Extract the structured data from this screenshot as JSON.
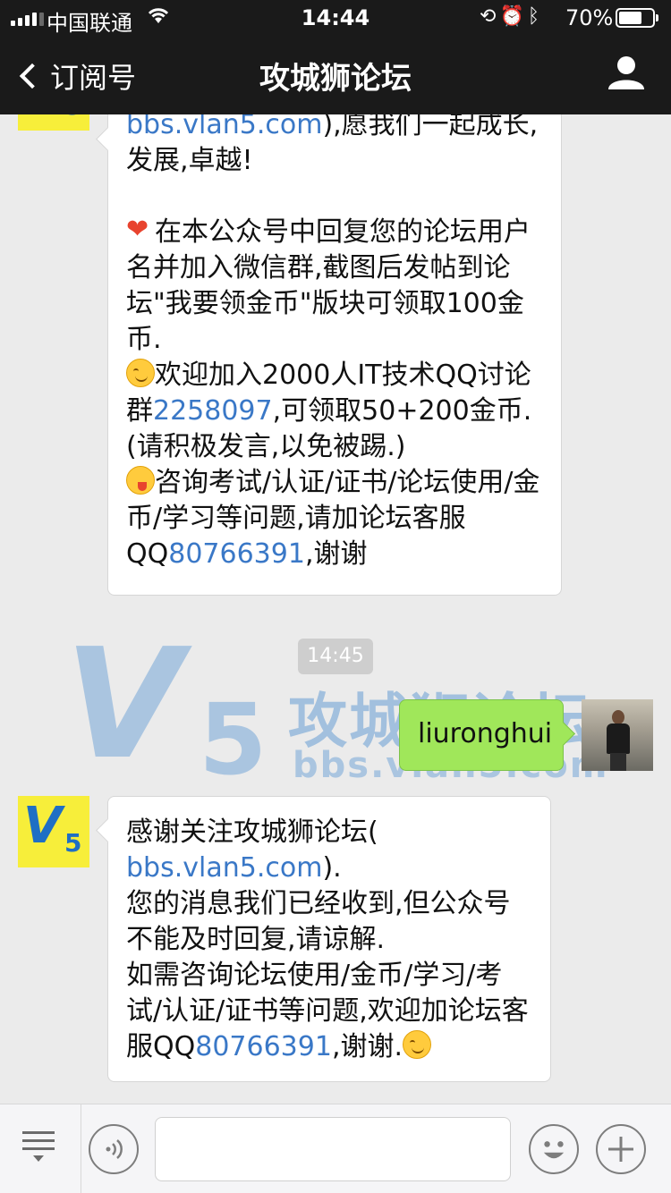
{
  "status_bar": {
    "carrier": "中国联通",
    "time": "14:44",
    "battery": "70%",
    "battery_level": 0.7
  },
  "nav": {
    "back_label": "订阅号",
    "title": "攻城狮论坛"
  },
  "messages": {
    "first_partial": {
      "line1_link": "bbs.vlan5.com",
      "line1_rest": "),愿我们一起成长,",
      "line2": "发展,卓越!",
      "heart_text": "在本公众号中回复您的论坛用户名并加入微信群,截图后发帖到论坛\"我要领金币\"版块可领取100金币.",
      "qq_group_prefix": "欢迎加入2000人IT技术QQ讨论群",
      "qq_group_number": "2258097",
      "qq_group_suffix": ",可领取50+200金币.(请积极发言,以免被踢.)",
      "consult_prefix": "咨询考试/认证/证书/论坛使用/金币/学习等问题,请加论坛客服QQ",
      "consult_qq": "80766391",
      "consult_suffix": ",谢谢"
    },
    "timestamp": "14:45",
    "user_message": "liuronghui",
    "reply": {
      "line1": "感谢关注攻城狮论坛(",
      "link": "bbs.vlan5.com",
      "link_suffix": ").",
      "body": "您的消息我们已经收到,但公众号不能及时回复,请谅解.",
      "help_text": "如需咨询论坛使用/金币/学习/考试/认证/证书等问题,欢迎加论坛客服QQ",
      "qq": "80766391",
      "suffix": ",谢谢."
    }
  },
  "watermark": {
    "title": "攻城狮论坛",
    "url": "bbs.vlan5.com"
  },
  "avatar_brand": {
    "letter": "V",
    "number": "5"
  },
  "icons": {
    "back": "chevron-left-icon",
    "profile": "person-icon",
    "menu": "menu-icon",
    "voice": "voice-icon",
    "emoji": "emoji-icon",
    "plus": "plus-icon"
  },
  "colors": {
    "bar_bg": "#1a1a1a",
    "chat_bg": "#ebebeb",
    "link": "#3a78c7",
    "user_bubble": "#a0e75a",
    "avatar_bg": "#f7ee3a"
  }
}
